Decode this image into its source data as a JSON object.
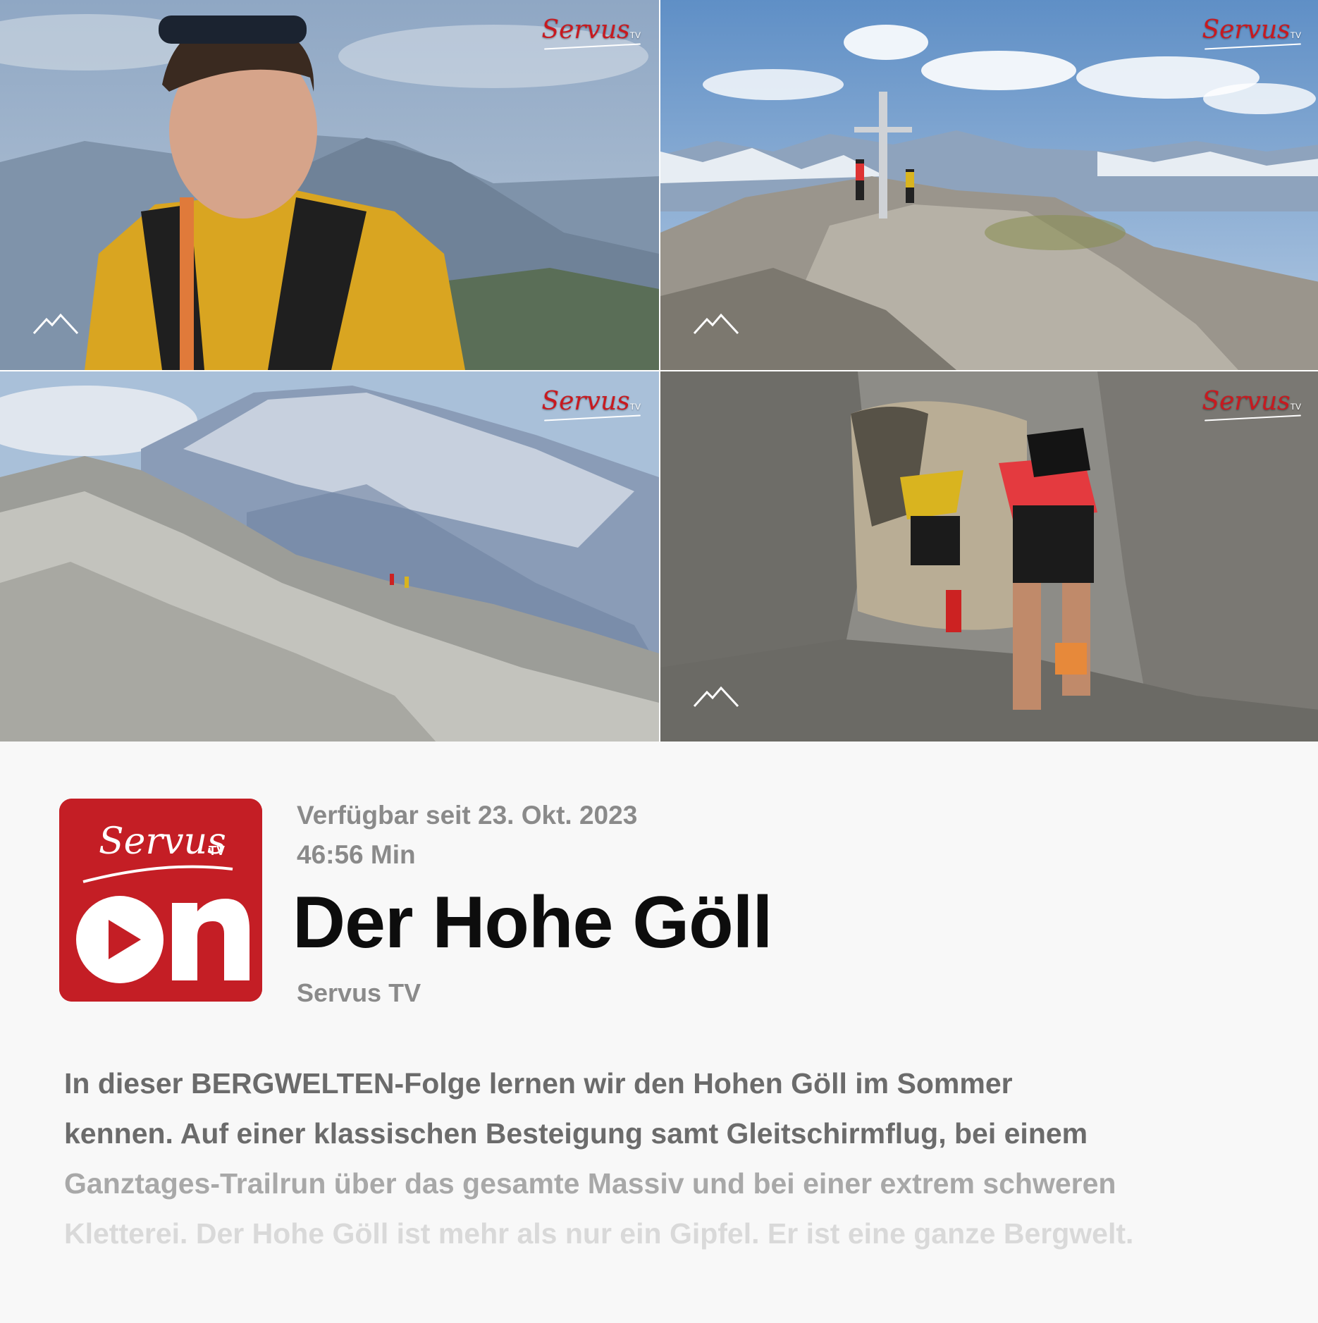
{
  "thumbnails": [
    {
      "alt": "Bergsteiger mit gelbem Shirt vor Bergpanorama",
      "watermark": "Servus",
      "watermark_tv": "TV"
    },
    {
      "alt": "Gipfelkreuz am Hohen Göll mit zwei Läufern",
      "watermark": "Servus",
      "watermark_tv": "TV"
    },
    {
      "alt": "Zwei Läufer auf felsigem Grat vor Watzmann",
      "watermark": "Servus",
      "watermark_tv": "TV"
    },
    {
      "alt": "Zwei Läufer klettern durch ein Felsloch",
      "watermark": "Servus",
      "watermark_tv": "TV"
    }
  ],
  "logo": {
    "brand": "Servus",
    "brand_suffix": "TV",
    "product": "on",
    "color": "#c41e25"
  },
  "meta": {
    "available": "Verfügbar seit 23. Okt. 2023",
    "duration": "46:56 Min"
  },
  "title": "Der Hohe Göll",
  "channel": "Servus TV",
  "description": {
    "lines": [
      "In dieser BERGWELTEN-Folge lernen wir den Hohen Göll im Sommer",
      "kennen. Auf einer klassischen Besteigung samt Gleitschirmflug, bei einem",
      "Ganztages-Trailrun über das gesamte Massiv und bei einer extrem schweren",
      "Kletterei. Der Hohe Göll ist mehr als nur ein Gipfel. Er ist eine ganze Bergwelt."
    ]
  }
}
